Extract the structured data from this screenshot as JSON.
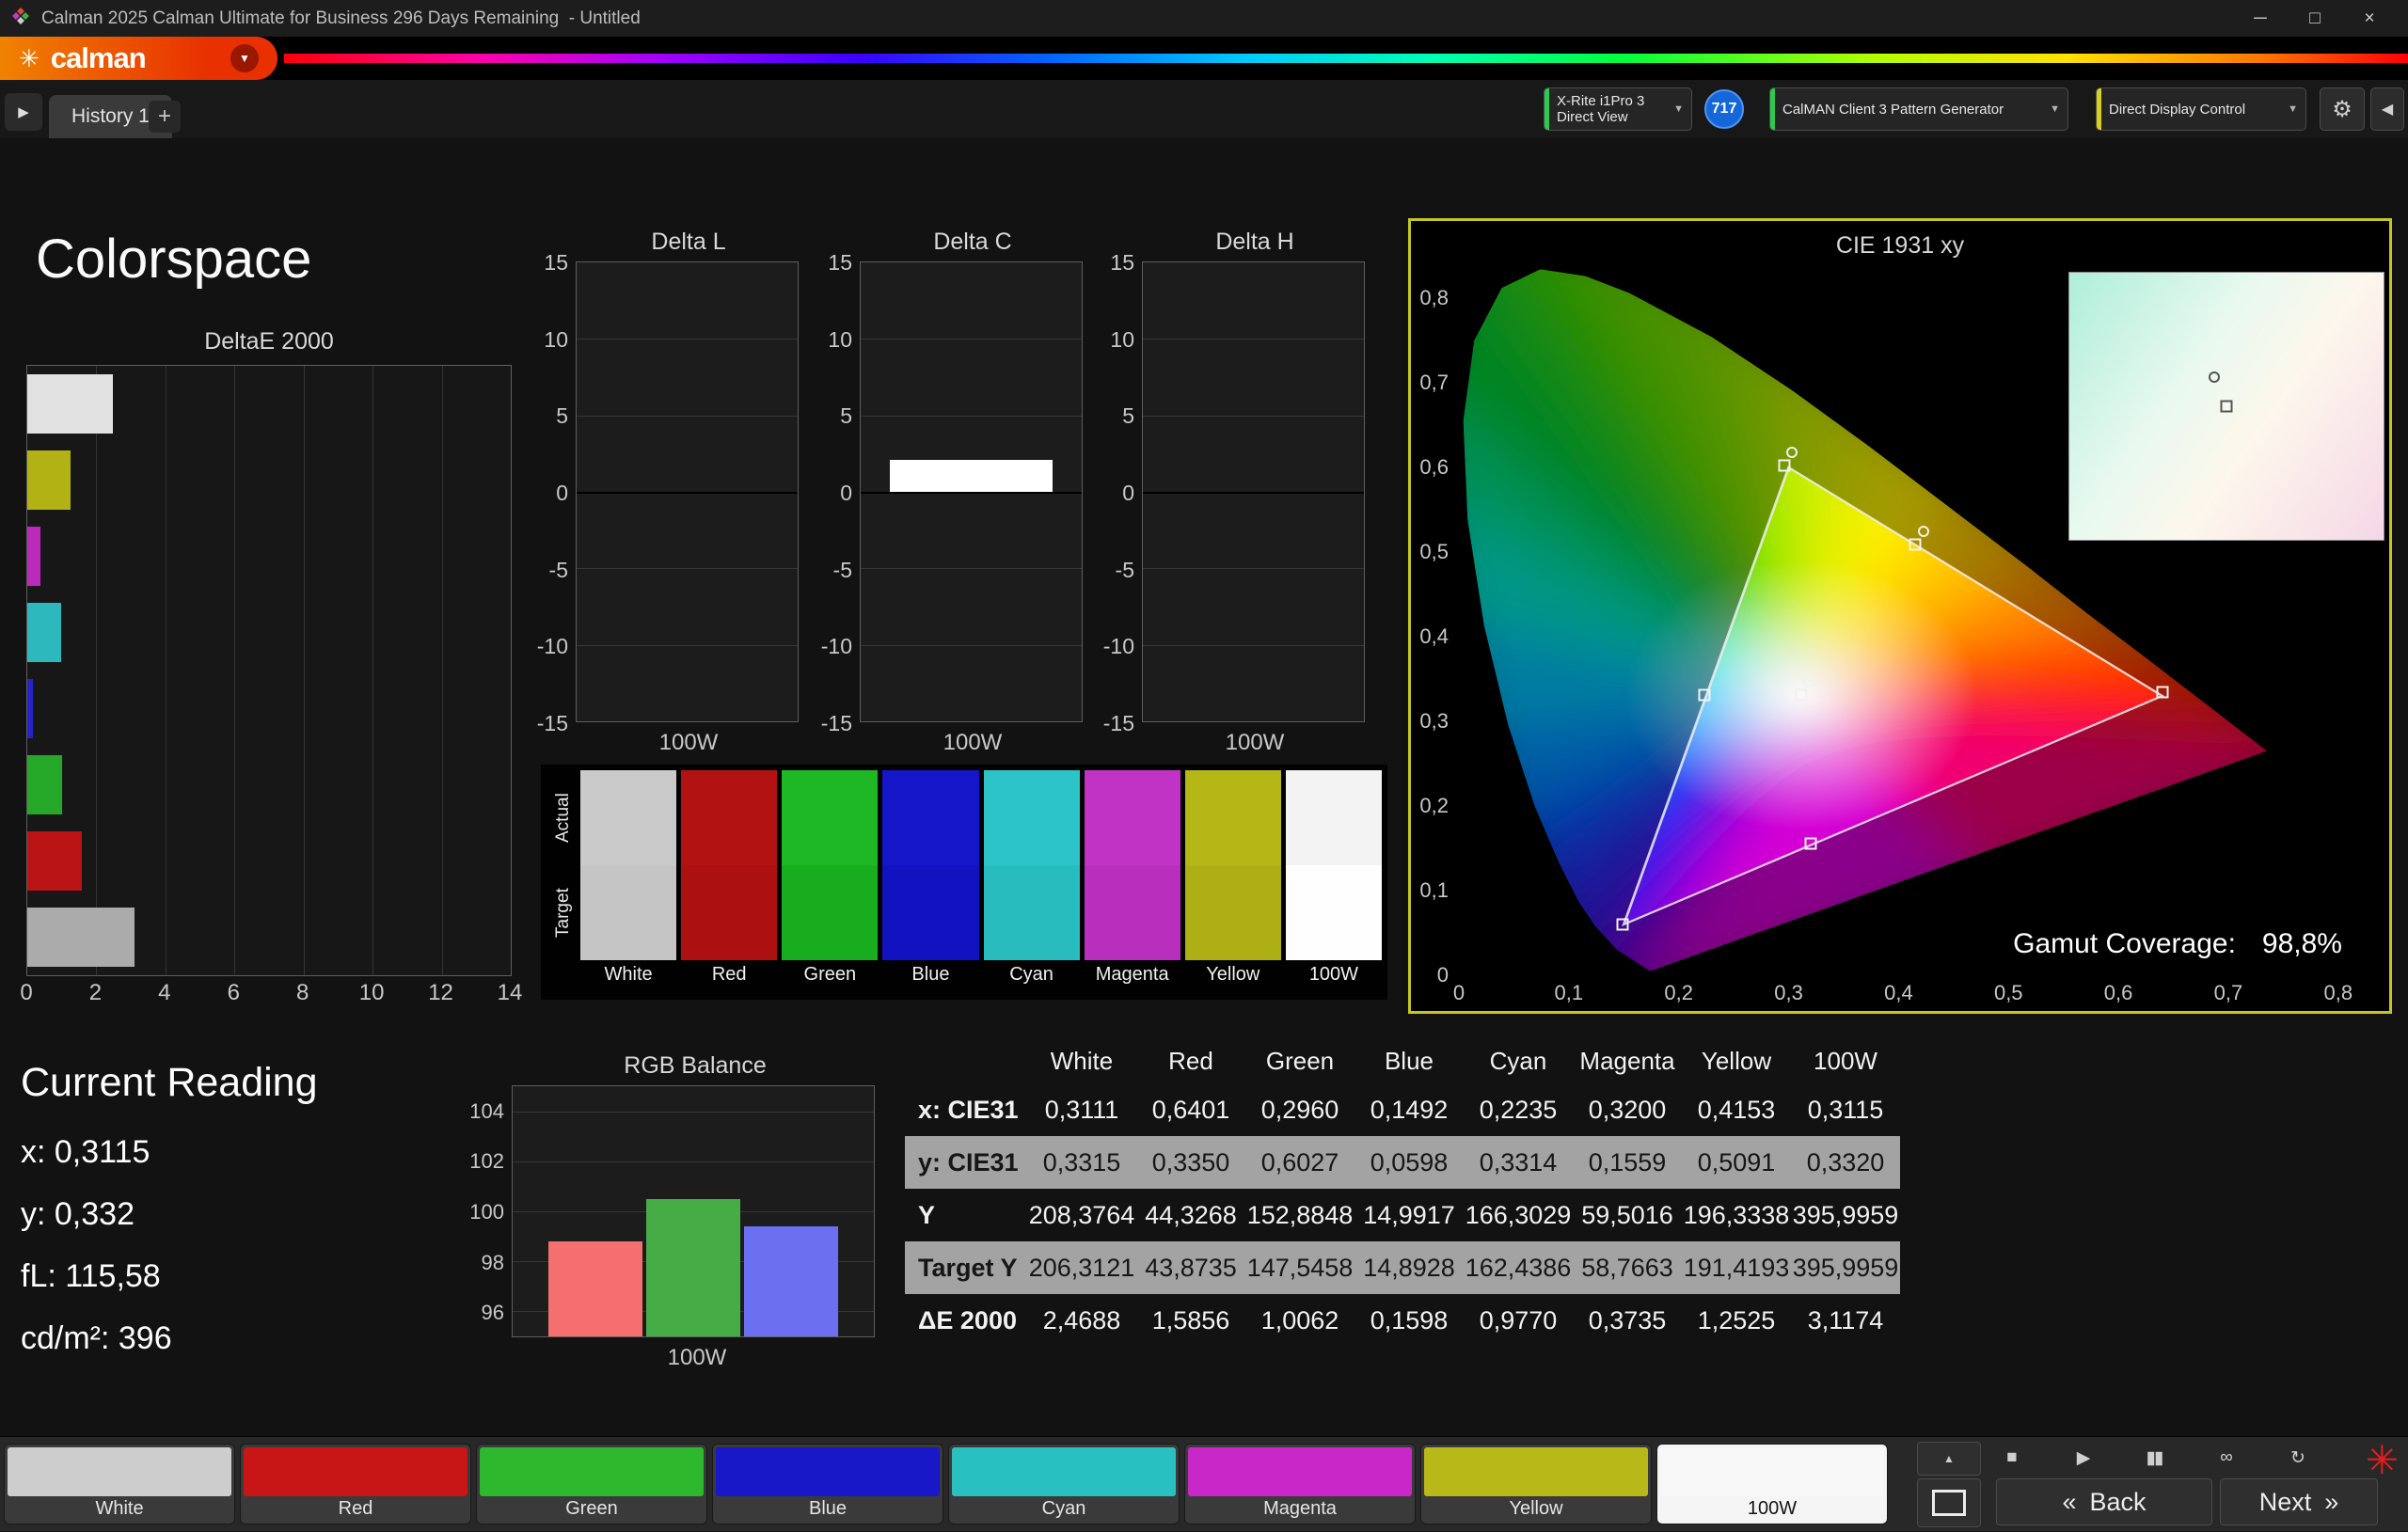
{
  "window": {
    "title": "Calman 2025 Calman Ultimate for Business 296 Days Remaining  - Untitled",
    "minimize": "─",
    "maximize": "□",
    "close": "×"
  },
  "logo": {
    "text": "calman"
  },
  "icons": {
    "logo_flower": "✳",
    "caret_down": "▼",
    "gear": "⚙",
    "collapse_left": "◀",
    "expand_tab": "▶",
    "tray_up": "▲",
    "asterisk": "✳",
    "back_chevron": "«",
    "next_chevron": "»"
  },
  "tabs": {
    "history": "History 1",
    "add": "+"
  },
  "toolbar": {
    "meter_line1": "X-Rite i1Pro 3",
    "meter_line2": "Direct View",
    "badge": "717",
    "pattern_generator": "CalMAN Client 3 Pattern Generator",
    "display_control": "Direct Display Control",
    "accent_green": "#2dc84d",
    "accent_yellow": "#d6d21c"
  },
  "page": {
    "title": "Colorspace"
  },
  "chart_data": [
    {
      "id": "deltae2000",
      "type": "bar",
      "orientation": "horizontal",
      "title": "DeltaE 2000",
      "categories": [
        "White",
        "Yellow",
        "Magenta",
        "Cyan",
        "Blue",
        "Green",
        "Red",
        "100W"
      ],
      "values": [
        2.4688,
        1.2525,
        0.3735,
        0.977,
        0.1598,
        1.0062,
        1.5856,
        3.1174
      ],
      "colors": [
        "#e2e2e2",
        "#b2b214",
        "#bb2abb",
        "#2db8bd",
        "#2424c8",
        "#25a827",
        "#bb1414",
        "#ababab"
      ],
      "xlim": [
        0,
        14
      ],
      "xticks": [
        0,
        2,
        4,
        6,
        8,
        10,
        12,
        14
      ]
    },
    {
      "id": "delta_l",
      "type": "bar",
      "title": "Delta L",
      "categories": [
        "100W"
      ],
      "values": [
        0
      ],
      "ylim": [
        -15,
        15
      ],
      "yticks": [
        15,
        10,
        5,
        0,
        -5,
        -10,
        -15
      ],
      "xlabel": "100W"
    },
    {
      "id": "delta_c",
      "type": "bar",
      "title": "Delta C",
      "categories": [
        "100W"
      ],
      "values": [
        2.1
      ],
      "bar_color": "#ffffff",
      "ylim": [
        -15,
        15
      ],
      "yticks": [
        15,
        10,
        5,
        0,
        -5,
        -10,
        -15
      ],
      "xlabel": "100W"
    },
    {
      "id": "delta_h",
      "type": "bar",
      "title": "Delta H",
      "categories": [
        "100W"
      ],
      "values": [
        0
      ],
      "ylim": [
        -15,
        15
      ],
      "yticks": [
        15,
        10,
        5,
        0,
        -5,
        -10,
        -15
      ],
      "xlabel": "100W"
    },
    {
      "id": "rgb_balance",
      "type": "bar",
      "title": "RGB Balance",
      "categories": [
        "Red",
        "Green",
        "Blue"
      ],
      "values": [
        98.8,
        100.5,
        99.4
      ],
      "colors": [
        "#f56f6f",
        "#46ad46",
        "#6a70f0"
      ],
      "ylim": [
        95,
        105
      ],
      "yticks": [
        104,
        102,
        100,
        98,
        96
      ],
      "xlabel": "100W"
    },
    {
      "id": "cie1931",
      "type": "scatter",
      "title": "CIE 1931 xy",
      "xmax": 0.813,
      "ymax": 0.84,
      "xticks": [
        {
          "v": 0,
          "label": "0"
        },
        {
          "v": 0.1,
          "label": "0,1"
        },
        {
          "v": 0.2,
          "label": "0,2"
        },
        {
          "v": 0.3,
          "label": "0,3"
        },
        {
          "v": 0.4,
          "label": "0,4"
        },
        {
          "v": 0.5,
          "label": "0,5"
        },
        {
          "v": 0.6,
          "label": "0,6"
        },
        {
          "v": 0.7,
          "label": "0,7"
        },
        {
          "v": 0.8,
          "label": "0,8"
        }
      ],
      "yticks": [
        {
          "v": 0,
          "label": "0"
        },
        {
          "v": 0.1,
          "label": "0,1"
        },
        {
          "v": 0.2,
          "label": "0,2"
        },
        {
          "v": 0.3,
          "label": "0,3"
        },
        {
          "v": 0.4,
          "label": "0,4"
        },
        {
          "v": 0.5,
          "label": "0,5"
        },
        {
          "v": 0.6,
          "label": "0,6"
        },
        {
          "v": 0.7,
          "label": "0,7"
        },
        {
          "v": 0.8,
          "label": "0,8"
        }
      ],
      "triangle": [
        [
          0.64,
          0.33
        ],
        [
          0.3,
          0.6
        ],
        [
          0.15,
          0.06
        ]
      ],
      "points": [
        {
          "name": "White",
          "x": 0.3111,
          "y": 0.3315,
          "ring": true
        },
        {
          "name": "Red",
          "x": 0.6401,
          "y": 0.335
        },
        {
          "name": "Green",
          "x": 0.296,
          "y": 0.6027,
          "ring": true
        },
        {
          "name": "Blue",
          "x": 0.1492,
          "y": 0.0598
        },
        {
          "name": "Cyan",
          "x": 0.2235,
          "y": 0.3314
        },
        {
          "name": "Magenta",
          "x": 0.32,
          "y": 0.1559
        },
        {
          "name": "Yellow",
          "x": 0.4153,
          "y": 0.5091,
          "ring": true
        },
        {
          "name": "100W",
          "x": 0.3115,
          "y": 0.332
        }
      ],
      "gamut_label": "Gamut Coverage:",
      "gamut_value": "98,8%",
      "inset_markers": [
        {
          "type": "ring",
          "x": 46,
          "y": 39
        },
        {
          "type": "square",
          "x": 50,
          "y": 50
        }
      ]
    }
  ],
  "swatch_panel": {
    "row_labels": [
      "Actual",
      "Target"
    ],
    "columns": [
      {
        "label": "White",
        "actual": "#cacaca",
        "target": "#c5c5c5"
      },
      {
        "label": "Red",
        "actual": "#b31212",
        "target": "#ac1010"
      },
      {
        "label": "Green",
        "actual": "#1db823",
        "target": "#18ad1e"
      },
      {
        "label": "Blue",
        "actual": "#1515ca",
        "target": "#1212c0"
      },
      {
        "label": "Cyan",
        "actual": "#2cc4c6",
        "target": "#28bcbe"
      },
      {
        "label": "Magenta",
        "actual": "#c133c5",
        "target": "#b92fbd"
      },
      {
        "label": "Yellow",
        "actual": "#b5b717",
        "target": "#adaf15"
      },
      {
        "label": "100W",
        "actual": "#f3f3f3",
        "target": "#fefefe"
      }
    ]
  },
  "current_reading": {
    "title": "Current Reading",
    "lines": [
      "x: 0,3115",
      "y: 0,332",
      "fL: 115,58",
      "cd/m²: 396"
    ]
  },
  "table": {
    "columns": [
      "White",
      "Red",
      "Green",
      "Blue",
      "Cyan",
      "Magenta",
      "Yellow",
      "100W"
    ],
    "rows": [
      {
        "label": "x: CIE31",
        "values": [
          "0,3111",
          "0,6401",
          "0,2960",
          "0,1492",
          "0,2235",
          "0,3200",
          "0,4153",
          "0,3115"
        ]
      },
      {
        "label": "y: CIE31",
        "values": [
          "0,3315",
          "0,3350",
          "0,6027",
          "0,0598",
          "0,3314",
          "0,1559",
          "0,5091",
          "0,3320"
        ]
      },
      {
        "label": "Y",
        "values": [
          "208,3764",
          "44,3268",
          "152,8848",
          "14,9917",
          "166,3029",
          "59,5016",
          "196,3338",
          "395,9959"
        ]
      },
      {
        "label": "Target Y",
        "values": [
          "206,3121",
          "43,8735",
          "147,5458",
          "14,8928",
          "162,4386",
          "58,7663",
          "191,4193",
          "395,9959"
        ]
      },
      {
        "label": "ΔE 2000",
        "values": [
          "2,4688",
          "1,5856",
          "1,0062",
          "0,1598",
          "0,9770",
          "0,3735",
          "1,2525",
          "3,1174"
        ]
      }
    ]
  },
  "bottom_bar": {
    "patterns": [
      {
        "label": "White",
        "color": "#cdcdcd"
      },
      {
        "label": "Red",
        "color": "#c81616"
      },
      {
        "label": "Green",
        "color": "#2eb82e"
      },
      {
        "label": "Blue",
        "color": "#1818c8"
      },
      {
        "label": "Cyan",
        "color": "#28c0c0"
      },
      {
        "label": "Magenta",
        "color": "#c828c8"
      },
      {
        "label": "Yellow",
        "color": "#b8b818"
      },
      {
        "label": "100W",
        "color": "#f8f8f8",
        "dark_text": true
      }
    ],
    "back": "Back",
    "next": "Next"
  },
  "transport": {
    "icons": [
      {
        "name": "stop",
        "glyph": "■"
      },
      {
        "name": "play",
        "glyph": "▶"
      },
      {
        "name": "pause",
        "glyph": "▮▮"
      },
      {
        "name": "loop",
        "glyph": "∞"
      },
      {
        "name": "refresh",
        "glyph": "↻"
      }
    ]
  }
}
